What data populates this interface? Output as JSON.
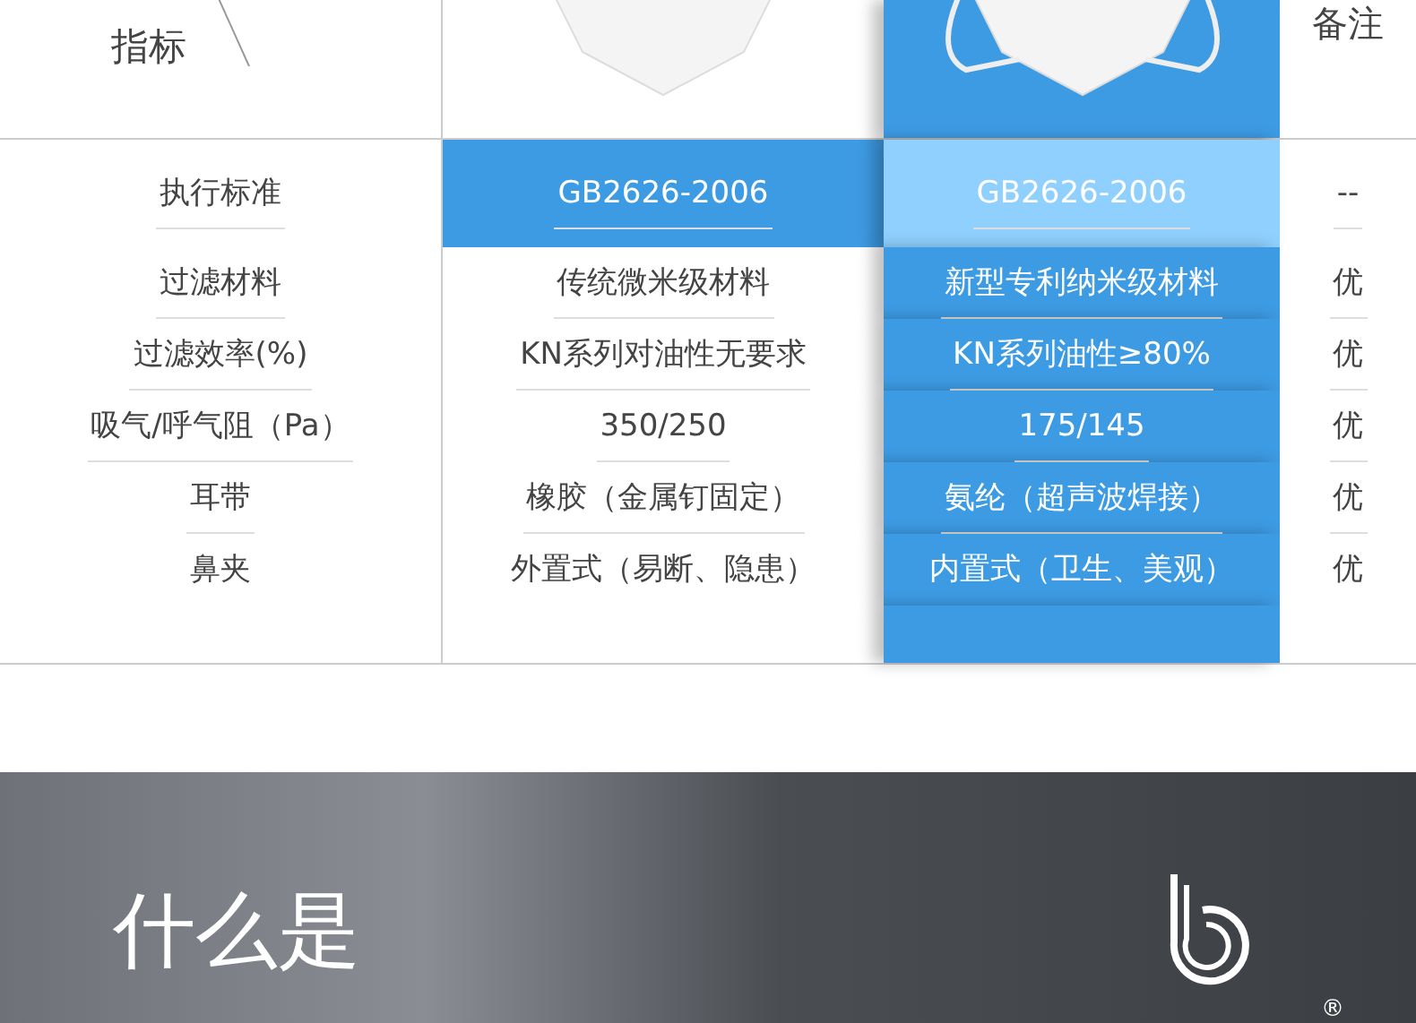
{
  "table": {
    "columns": [
      {
        "kind": "label",
        "label": "指标"
      },
      {
        "kind": "image",
        "selected": false
      },
      {
        "kind": "image",
        "selected": true
      },
      {
        "kind": "note",
        "label": "备注"
      }
    ],
    "rows": [
      {
        "highlighted": true,
        "cells": [
          "执行标准",
          "GB2626-2006",
          "GB2626-2006",
          "--"
        ]
      },
      {
        "highlighted": false,
        "cells": [
          "过滤材料",
          "传统微米级材料",
          "新型专利纳米级材料",
          "优"
        ]
      },
      {
        "highlighted": false,
        "cells": [
          "过滤效率(%)",
          "KN系列对油性无要求",
          "KN系列油性≥80%",
          "优"
        ]
      },
      {
        "highlighted": false,
        "cells": [
          "吸气/呼气阻（Pa）",
          "350/250",
          "175/145",
          "优"
        ]
      },
      {
        "highlighted": false,
        "cells": [
          "耳带",
          "橡胶（金属钉固定）",
          "氨纶（超声波焊接）",
          "优"
        ]
      },
      {
        "highlighted": false,
        "cells": [
          "鼻夹",
          "外置式（易断、隐患）",
          "内置式（卫生、美观）",
          "优"
        ]
      }
    ]
  },
  "banner": {
    "headline": "什么是",
    "logo_mark": "®"
  }
}
